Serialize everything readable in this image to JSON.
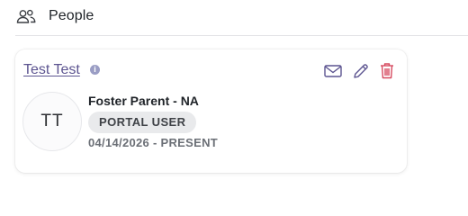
{
  "section": {
    "title": "People",
    "icon": "people-icon"
  },
  "person": {
    "name": "Test Test",
    "initials": "TT",
    "role": "Foster Parent - NA",
    "badge": "PORTAL USER",
    "date_range": "04/14/2026 - PRESENT"
  },
  "actions": [
    {
      "name": "email",
      "icon": "mail-icon"
    },
    {
      "name": "edit",
      "icon": "pencil-icon"
    },
    {
      "name": "delete",
      "icon": "trash-icon"
    }
  ],
  "colors": {
    "link": "#5c5490",
    "icon_accent": "#5c5490",
    "delete": "#d64a5f",
    "info": "#9a9dc4"
  }
}
